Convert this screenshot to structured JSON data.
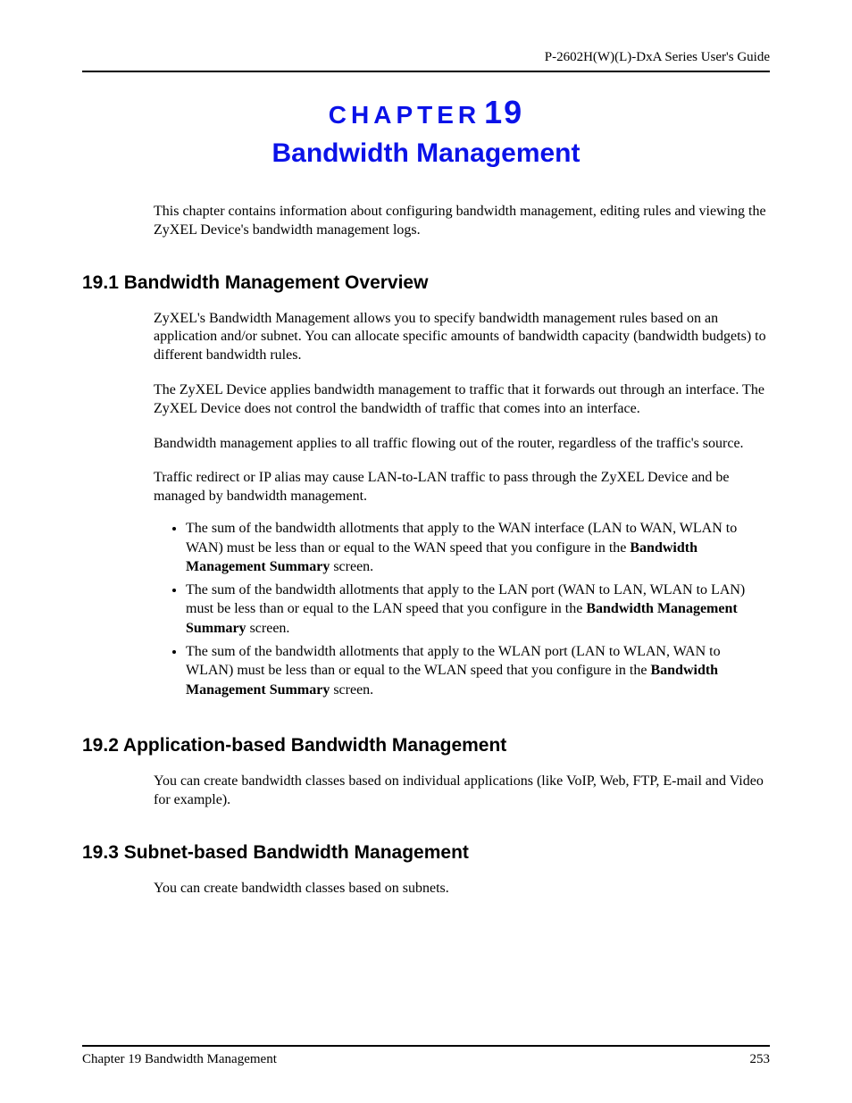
{
  "header": {
    "guide_title": "P-2602H(W)(L)-DxA Series User's Guide"
  },
  "chapter": {
    "kicker_word": "CHAPTER",
    "kicker_number": "19",
    "title": "Bandwidth Management"
  },
  "intro": "This chapter contains information about configuring bandwidth management, editing rules and viewing the ZyXEL Device's bandwidth management logs.",
  "sections": {
    "s1": {
      "heading": "19.1  Bandwidth Management Overview",
      "p1": "ZyXEL's Bandwidth Management allows you to specify bandwidth management rules based on an application and/or subnet. You can allocate specific amounts of bandwidth capacity (bandwidth budgets) to different bandwidth rules.",
      "p2": "The ZyXEL Device applies bandwidth management to traffic that it forwards out through an interface. The ZyXEL Device does not control the bandwidth of traffic that comes into an interface.",
      "p3": "Bandwidth management applies to all traffic flowing out of the router, regardless of the traffic's source.",
      "p4": "Traffic redirect or IP alias may cause LAN-to-LAN traffic to pass through the ZyXEL Device and be managed by bandwidth management.",
      "bullets": {
        "b1_pre": "The sum of the bandwidth allotments that apply to the WAN interface (LAN to WAN, WLAN to WAN) must be less than or equal to the WAN speed that you configure in the ",
        "b1_bold": "Bandwidth Management Summary",
        "b1_post": " screen.",
        "b2_pre": "The sum of the bandwidth allotments that apply to the LAN port (WAN to LAN, WLAN to LAN) must be less than or equal to the LAN speed that you configure in the ",
        "b2_bold": "Bandwidth Management Summary",
        "b2_post": " screen.",
        "b3_pre": "The sum of the bandwidth allotments that apply to the WLAN port (LAN to WLAN, WAN to WLAN) must be less than or equal to the WLAN speed that you configure in the ",
        "b3_bold": "Bandwidth Management Summary",
        "b3_post": " screen."
      }
    },
    "s2": {
      "heading": "19.2  Application-based Bandwidth Management",
      "p1": "You can create bandwidth classes based on individual applications (like VoIP, Web, FTP, E-mail and Video for example)."
    },
    "s3": {
      "heading": "19.3  Subnet-based Bandwidth Management",
      "p1": "You can create bandwidth classes based on subnets."
    }
  },
  "footer": {
    "left": "Chapter 19 Bandwidth Management",
    "right": "253"
  }
}
